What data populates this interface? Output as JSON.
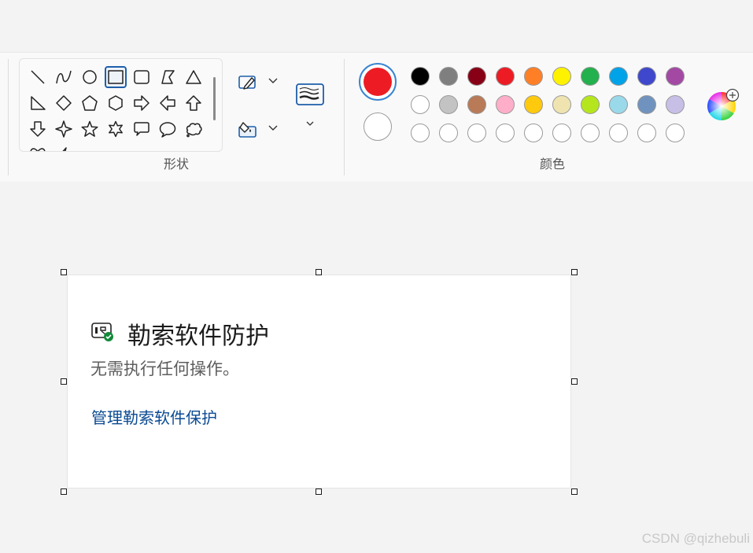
{
  "ribbon": {
    "shapes_label": "形状",
    "colors_label": "颜色",
    "shapes": [
      "line-shape",
      "curve-shape",
      "oval-shape",
      "rectangle-shape",
      "rounded-rectangle-shape",
      "polygon-shape",
      "triangle-shape",
      "right-triangle-shape",
      "diamond-shape",
      "pentagon-shape",
      "hexagon-shape",
      "right-arrow-shape",
      "left-arrow-shape",
      "up-arrow-shape",
      "down-arrow-shape",
      "four-point-star-shape",
      "five-point-star-shape",
      "six-point-star-shape",
      "rounded-callout-shape",
      "oval-callout-shape",
      "cloud-callout-shape"
    ],
    "selected_shape": "rectangle-shape",
    "primary_color": "#ed1c24",
    "secondary_color": "#ffffff",
    "palette_row1": [
      "#000000",
      "#7f7f7f",
      "#880015",
      "#ed1c24",
      "#ff7f27",
      "#fff200",
      "#22b14c",
      "#00a2e8",
      "#3f48cc",
      "#a349a4"
    ],
    "palette_row2": [
      "#ffffff",
      "#c3c3c3",
      "#b97a57",
      "#ffaec9",
      "#ffc90e",
      "#efe4b0",
      "#b5e61d",
      "#99d9ea",
      "#7092be",
      "#c8bfe7"
    ],
    "palette_row3": [
      "#ffffff",
      "#ffffff",
      "#ffffff",
      "#ffffff",
      "#ffffff",
      "#ffffff",
      "#ffffff",
      "#ffffff",
      "#ffffff",
      "#ffffff"
    ]
  },
  "card": {
    "title": "勒索软件防护",
    "subtitle": "无需执行任何操作。",
    "link": "管理勒索软件保护"
  },
  "watermark": "CSDN @qizhebuli"
}
